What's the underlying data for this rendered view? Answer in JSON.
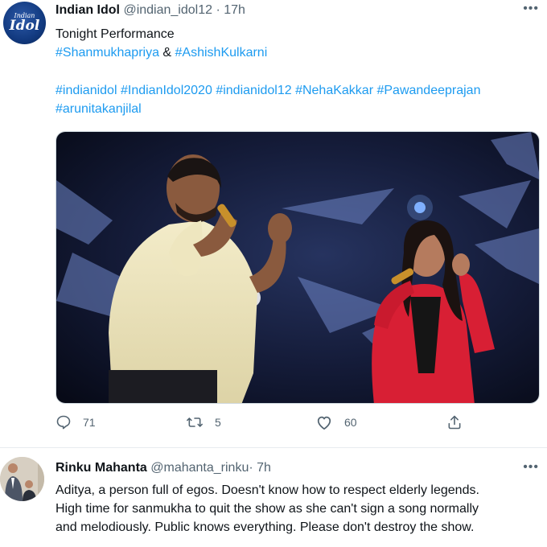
{
  "tweet": {
    "display_name": "Indian Idol",
    "handle": "@indian_idol12",
    "separator": "·",
    "time": "17h",
    "more": "•••",
    "avatar_logo_line1": "Indian",
    "avatar_logo_line2": "Idol",
    "line1": "Tonight Performance",
    "mention1": "#Shanmukhapriya",
    "amp": " & ",
    "mention2": "#AshishKulkarni",
    "hashtags_line1": [
      "#indianidol",
      "#IndianIdol2020",
      "#indianidol12",
      "#NehaKakkar",
      "#Pawandeeprajan"
    ],
    "hashtags_line2": [
      "#arunitakanjilal"
    ],
    "actions": {
      "reply_count": "71",
      "retweet_count": "5",
      "like_count": "60"
    }
  },
  "reply": {
    "display_name": "Rinku Mahanta",
    "handle": "@mahanta_rinku",
    "separator": "·",
    "time": "7h",
    "more": "•••",
    "lines": [
      "Aditya, a person full of egos. Doesn't know how to respect elderly legends.",
      "High time for sanmukha to quit the show as she can't sign a song normally",
      "and melodiously. Public knows everything. Please don't destroy the show."
    ]
  },
  "colors": {
    "link": "#1d9bf0",
    "muted": "#536471",
    "text": "#0f1419"
  },
  "icons": [
    "reply-icon",
    "retweet-icon",
    "like-icon",
    "share-icon",
    "more-icon"
  ]
}
